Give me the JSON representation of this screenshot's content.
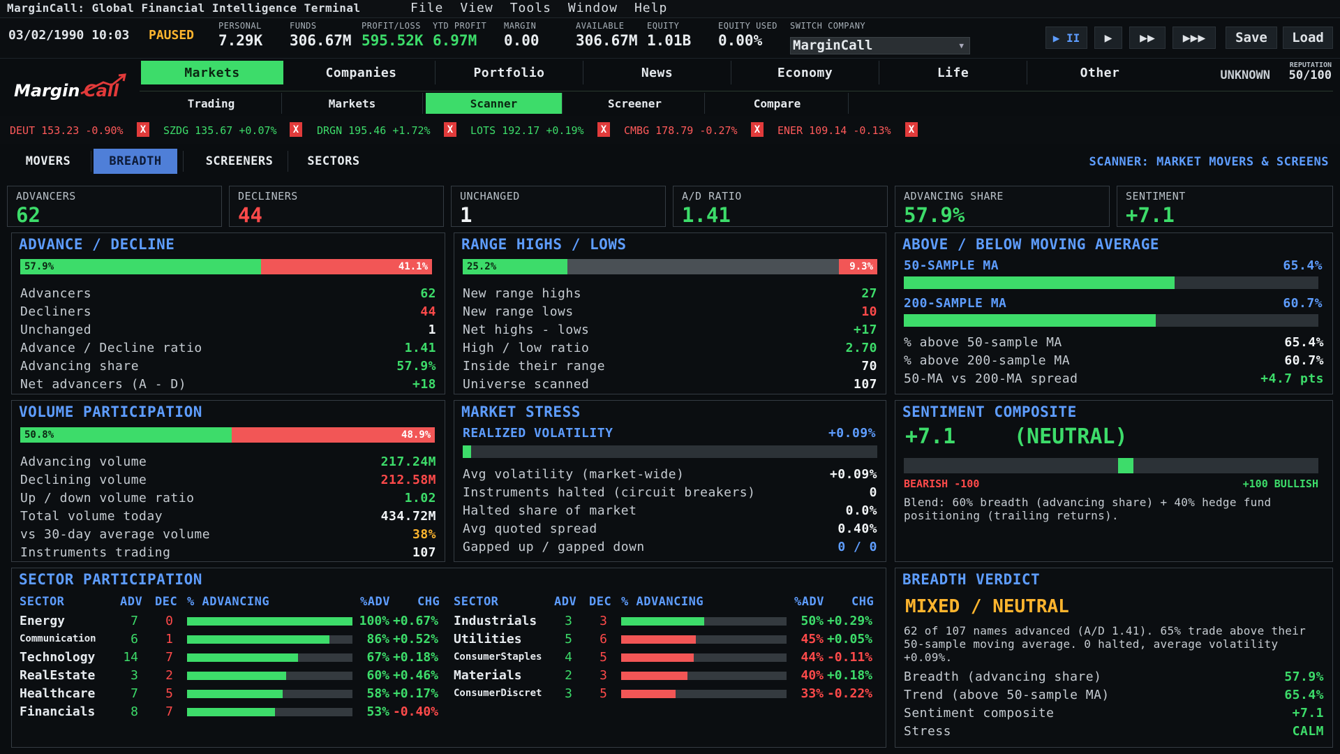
{
  "window": {
    "title": "MarginCall: Global Financial Intelligence Terminal"
  },
  "menu": [
    "File",
    "View",
    "Tools",
    "Window",
    "Help"
  ],
  "status": {
    "date": "03/02/1990 10:03",
    "state": "PAUSED",
    "stats": [
      {
        "label": "PERSONAL",
        "value": "7.29K",
        "color": "#e9edf0"
      },
      {
        "label": "FUNDS",
        "value": "306.67M",
        "color": "#e9edf0"
      },
      {
        "label": "PROFIT/LOSS",
        "value": "595.52K",
        "color": "#3ddc6a"
      },
      {
        "label": "YTD PROFIT",
        "value": "6.97M",
        "color": "#3ddc6a"
      },
      {
        "label": "MARGIN",
        "value": "0.00",
        "color": "#e9edf0"
      },
      {
        "label": "AVAILABLE",
        "value": "306.67M",
        "color": "#e9edf0"
      },
      {
        "label": "EQUITY",
        "value": "1.01B",
        "color": "#e9edf0"
      },
      {
        "label": "EQUITY USED",
        "value": "0.00%",
        "color": "#e9edf0"
      },
      {
        "label": "SWITCH COMPANY",
        "value": "",
        "color": "#e9edf0"
      }
    ],
    "company": "MarginCall",
    "controls": {
      "pause": "▶ II",
      "play": "▶",
      "fast": "▶▶",
      "fastest": "▶▶▶",
      "save": "Save",
      "load": "Load"
    }
  },
  "logo": {
    "text_a": "Margin",
    "text_b": "Call"
  },
  "tabs": [
    "Markets",
    "Companies",
    "Portfolio",
    "News",
    "Economy",
    "Life",
    "Other"
  ],
  "subtabs": [
    "Trading",
    "Markets",
    "Scanner",
    "Screener",
    "Compare"
  ],
  "reputation": {
    "status": "UNKNOWN",
    "label": "REPUTATION",
    "value": "50/100"
  },
  "ticker": [
    {
      "sym": "DEUT",
      "price": "153.23",
      "chg": "-0.90%"
    },
    {
      "sym": "SZDG",
      "price": "135.67",
      "chg": "+0.07%"
    },
    {
      "sym": "DRGN",
      "price": "195.46",
      "chg": "+1.72%"
    },
    {
      "sym": "LOTS",
      "price": "192.17",
      "chg": "+0.19%"
    },
    {
      "sym": "CMBG",
      "price": "178.79",
      "chg": "-0.27%"
    },
    {
      "sym": "ENER",
      "price": "109.14",
      "chg": "-0.13%"
    }
  ],
  "ticker_close": "X",
  "subnav": [
    "MOVERS",
    "BREADTH",
    "SCREENERS",
    "SECTORS"
  ],
  "scanner_label": "SCANNER: MARKET MOVERS & SCREENS",
  "cards": [
    {
      "label": "ADVANCERS",
      "value": "62",
      "color": "#3ddc6a"
    },
    {
      "label": "DECLINERS",
      "value": "44",
      "color": "#ff4a4a"
    },
    {
      "label": "UNCHANGED",
      "value": "1",
      "color": "#f1f4f6"
    },
    {
      "label": "A/D RATIO",
      "value": "1.41",
      "color": "#3ddc6a"
    },
    {
      "label": "ADVANCING SHARE",
      "value": "57.9%",
      "color": "#3ddc6a"
    },
    {
      "label": "SENTIMENT",
      "value": "+7.1",
      "color": "#3ddc6a"
    }
  ],
  "advance_decline": {
    "title": "ADVANCE / DECLINE",
    "bar": {
      "green_label": "57.9%",
      "red_label": "41.1%",
      "green_frac": 0.579,
      "red_frac": 0.411
    },
    "rows": [
      {
        "k": "Advancers",
        "v": "62",
        "color": "#3ddc6a"
      },
      {
        "k": "Decliners",
        "v": "44",
        "color": "#ff4a4a"
      },
      {
        "k": "Unchanged",
        "v": "1",
        "color": "#f1f4f6"
      },
      {
        "k": "Advance / Decline ratio",
        "v": "1.41",
        "color": "#3ddc6a"
      },
      {
        "k": "Advancing share",
        "v": "57.9%",
        "color": "#3ddc6a"
      },
      {
        "k": "Net advancers (A - D)",
        "v": "+18",
        "color": "#3ddc6a"
      }
    ]
  },
  "range": {
    "title": "RANGE HIGHS / LOWS",
    "bar": {
      "green_label": "25.2%",
      "red_label": "9.3%",
      "green_frac": 0.252,
      "red_frac": 0.093
    },
    "rows": [
      {
        "k": "New range highs",
        "v": "27",
        "color": "#3ddc6a"
      },
      {
        "k": "New range lows",
        "v": "10",
        "color": "#ff4a4a"
      },
      {
        "k": "Net highs - lows",
        "v": "+17",
        "color": "#3ddc6a"
      },
      {
        "k": "High / low ratio",
        "v": "2.70",
        "color": "#3ddc6a"
      },
      {
        "k": "Inside their range",
        "v": "70",
        "color": "#f1f4f6"
      },
      {
        "k": "Universe scanned",
        "v": "107",
        "color": "#f1f4f6"
      }
    ]
  },
  "moving_avg": {
    "title": "ABOVE / BELOW MOVING AVERAGE",
    "ma50": {
      "label": "50-SAMPLE MA",
      "value": "65.4%",
      "frac": 0.654
    },
    "ma200": {
      "label": "200-SAMPLE MA",
      "value": "60.7%",
      "frac": 0.607
    },
    "rows": [
      {
        "k": "% above 50-sample MA",
        "v": "65.4%",
        "color": "#f1f4f6"
      },
      {
        "k": "% above 200-sample MA",
        "v": "60.7%",
        "color": "#f1f4f6"
      },
      {
        "k": "50-MA vs 200-MA spread",
        "v": "+4.7 pts",
        "color": "#3ddc6a"
      }
    ]
  },
  "volume": {
    "title": "VOLUME PARTICIPATION",
    "bar": {
      "green_label": "50.8%",
      "red_label": "48.9%",
      "green_frac": 0.508,
      "red_frac": 0.489
    },
    "rows": [
      {
        "k": "Advancing volume",
        "v": "217.24M",
        "color": "#3ddc6a"
      },
      {
        "k": "Declining volume",
        "v": "212.58M",
        "color": "#ff4a4a"
      },
      {
        "k": "Up / down volume ratio",
        "v": "1.02",
        "color": "#3ddc6a"
      },
      {
        "k": "Total volume today",
        "v": "434.72M",
        "color": "#f1f4f6"
      },
      {
        "k": "vs 30-day average volume",
        "v": "38%",
        "color": "#ffb52e"
      },
      {
        "k": "Instruments trading",
        "v": "107",
        "color": "#f1f4f6"
      }
    ]
  },
  "stress": {
    "title": "MARKET STRESS",
    "vol_label": "REALIZED VOLATILITY",
    "vol_value": "+0.09%",
    "vol_frac": 0.02,
    "rows": [
      {
        "k": "Avg volatility (market-wide)",
        "v": "+0.09%",
        "color": "#f1f4f6"
      },
      {
        "k": "Instruments halted (circuit breakers)",
        "v": "0",
        "color": "#f1f4f6"
      },
      {
        "k": "Halted share of market",
        "v": "0.0%",
        "color": "#f1f4f6"
      },
      {
        "k": "Avg quoted spread",
        "v": "0.40%",
        "color": "#f1f4f6"
      },
      {
        "k": "Gapped up / gapped down",
        "v": "0 / 0",
        "color": "#5e9dff"
      }
    ]
  },
  "sentiment": {
    "title": "SENTIMENT COMPOSITE",
    "value": "+7.1",
    "state": "(NEUTRAL)",
    "frac": 0.5355,
    "left_label": "BEARISH -100",
    "right_label": "+100 BULLISH",
    "note": "Blend: 60% breadth (advancing share) + 40% hedge fund positioning (trailing returns)."
  },
  "sectors": {
    "title": "SECTOR PARTICIPATION",
    "headers": {
      "sector": "SECTOR",
      "adv": "ADV",
      "dec": "DEC",
      "pct": "% ADVANCING",
      "padv": "%ADV",
      "chg": "CHG"
    },
    "left": [
      {
        "name": "Energy",
        "adv": "7",
        "dec": "0",
        "padv": "100%",
        "chg": "+0.67%",
        "frac": 1.0,
        "up": true,
        "small": false
      },
      {
        "name": "Communication",
        "adv": "6",
        "dec": "1",
        "padv": "86%",
        "chg": "+0.52%",
        "frac": 0.86,
        "up": true,
        "small": true
      },
      {
        "name": "Technology",
        "adv": "14",
        "dec": "7",
        "padv": "67%",
        "chg": "+0.18%",
        "frac": 0.67,
        "up": true,
        "small": false
      },
      {
        "name": "RealEstate",
        "adv": "3",
        "dec": "2",
        "padv": "60%",
        "chg": "+0.46%",
        "frac": 0.6,
        "up": true,
        "small": false
      },
      {
        "name": "Healthcare",
        "adv": "7",
        "dec": "5",
        "padv": "58%",
        "chg": "+0.17%",
        "frac": 0.58,
        "up": true,
        "small": false
      },
      {
        "name": "Financials",
        "adv": "8",
        "dec": "7",
        "padv": "53%",
        "chg": "-0.40%",
        "frac": 0.53,
        "up": false,
        "small": false
      }
    ],
    "right": [
      {
        "name": "Industrials",
        "adv": "3",
        "dec": "3",
        "padv": "50%",
        "chg": "+0.29%",
        "frac": 0.5,
        "up": true,
        "small": false
      },
      {
        "name": "Utilities",
        "adv": "5",
        "dec": "6",
        "padv": "45%",
        "chg": "+0.05%",
        "frac": 0.45,
        "up": true,
        "small": false
      },
      {
        "name": "ConsumerStaples",
        "adv": "4",
        "dec": "5",
        "padv": "44%",
        "chg": "-0.11%",
        "frac": 0.44,
        "up": false,
        "small": true
      },
      {
        "name": "Materials",
        "adv": "2",
        "dec": "3",
        "padv": "40%",
        "chg": "+0.18%",
        "frac": 0.4,
        "up": true,
        "small": false
      },
      {
        "name": "ConsumerDiscret",
        "adv": "3",
        "dec": "5",
        "padv": "33%",
        "chg": "-0.22%",
        "frac": 0.33,
        "up": false,
        "small": true
      }
    ]
  },
  "verdict": {
    "title": "BREADTH VERDICT",
    "headline": "MIXED / NEUTRAL",
    "text": "62 of 107 names advanced (A/D 1.41). 65% trade above their 50-sample moving average. 0 halted, average volatility +0.09%.",
    "rows": [
      {
        "k": "Breadth (advancing share)",
        "v": "57.9%",
        "color": "#3ddc6a"
      },
      {
        "k": "Trend (above 50-sample MA)",
        "v": "65.4%",
        "color": "#3ddc6a"
      },
      {
        "k": "Sentiment composite",
        "v": "+7.1",
        "color": "#3ddc6a"
      },
      {
        "k": "Stress",
        "v": "CALM",
        "color": "#3ddc6a"
      }
    ]
  }
}
